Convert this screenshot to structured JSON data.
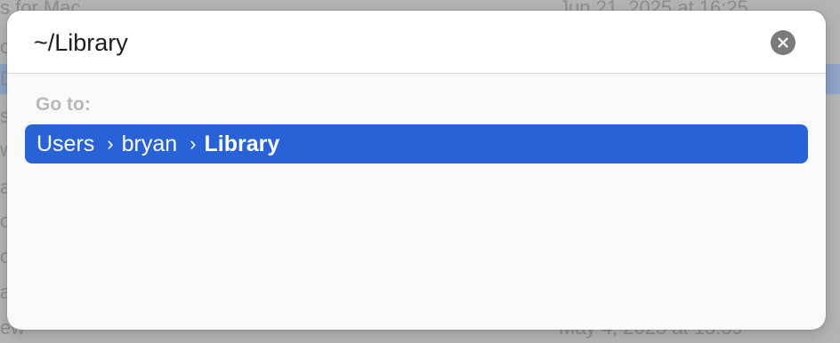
{
  "background": {
    "rows": [
      {
        "name": "s for Mac",
        "date": "Jun 21, 2025 at 16:25",
        "selected": false
      },
      {
        "name": "o",
        "date": "",
        "selected": false
      },
      {
        "name": "D",
        "date": "",
        "selected": true
      },
      {
        "name": "s",
        "date": "",
        "selected": false
      },
      {
        "name": "w",
        "date": "",
        "selected": false
      },
      {
        "name": "a",
        "date": "",
        "selected": false
      },
      {
        "name": "o",
        "date": "",
        "selected": false
      },
      {
        "name": "o",
        "date": "",
        "selected": false
      },
      {
        "name": "a",
        "date": "",
        "selected": false
      },
      {
        "name": "a",
        "date": "",
        "selected": false
      },
      {
        "name": "ew",
        "date": "May 4, 2025 at 13:39",
        "selected": false
      }
    ]
  },
  "goto": {
    "path_value": "~/Library",
    "clear_icon": "close-circle-icon",
    "section_label": "Go to:",
    "result": {
      "crumbs": [
        "Users",
        "bryan",
        "Library"
      ],
      "separator": "›"
    }
  },
  "colors": {
    "selection": "#2862d8",
    "sheet_background": "#f9f9f9",
    "label_gray": "#b8b8b8"
  }
}
